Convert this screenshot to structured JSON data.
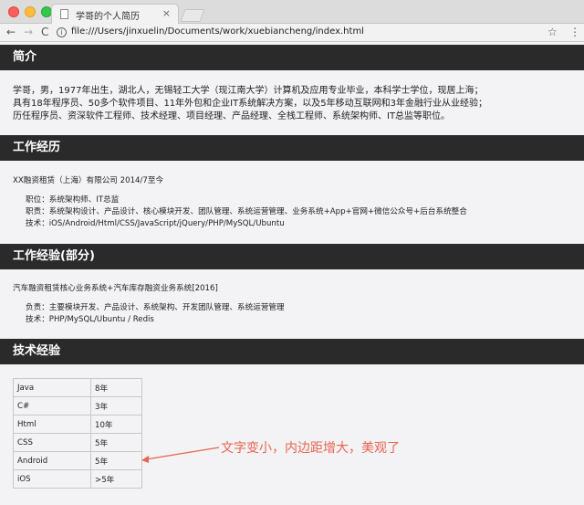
{
  "browser": {
    "tab_title": "学哥的个人简历",
    "tab_close": "×",
    "url": "file:///Users/jinxuelin/Documents/work/xuebiancheng/index.html",
    "nav_back": "←",
    "nav_forward": "→",
    "nav_reload": "C",
    "url_info": "i",
    "star": "☆",
    "menu": "⋮"
  },
  "sections": {
    "intro": {
      "heading": "简介",
      "lines": [
        "学哥，男，1977年出生，湖北人，无锡轻工大学（现江南大学）计算机及应用专业毕业，本科学士学位，现居上海；",
        "具有18年程序员、50多个软件项目、11年外包和企业IT系统解决方案，以及5年移动互联网和3年金融行业从业经验；",
        "历任程序员、资深软件工程师、技术经理、项目经理、产品经理、全栈工程师、系统架构师、IT总监等职位。"
      ]
    },
    "work": {
      "heading": "工作经历",
      "company": "XX融资租赁（上海）有限公司 2014/7至今",
      "details": [
        "职位：系统架构师、IT总监",
        "职责：系统架构设计、产品设计、核心模块开发、团队管理、系统运营管理、业务系统+App+官网+微信公众号+后台系统整合",
        "技术：iOS/Android/Html/CSS/JavaScript/jQuery/PHP/MySQL/Ubuntu"
      ]
    },
    "projects": {
      "heading": "工作经验(部分)",
      "project": "汽车融资租赁核心业务系统+汽车库存融资业务系统[2016]",
      "details": [
        "负责：主要模块开发、产品设计、系统架构、开发团队管理、系统运营管理",
        "技术：PHP/MySQL/Ubuntu / Redis"
      ]
    },
    "skills": {
      "heading": "技术经验",
      "rows": [
        {
          "name": "Java",
          "years": "8年"
        },
        {
          "name": "C#",
          "years": "3年"
        },
        {
          "name": "Html",
          "years": "10年"
        },
        {
          "name": "CSS",
          "years": "5年"
        },
        {
          "name": "Android",
          "years": "5年"
        },
        {
          "name": "iOS",
          "years": ">5年"
        }
      ]
    }
  },
  "annotation": {
    "text": "文字变小，内边距增大，美观了",
    "color": "#e8654f"
  }
}
